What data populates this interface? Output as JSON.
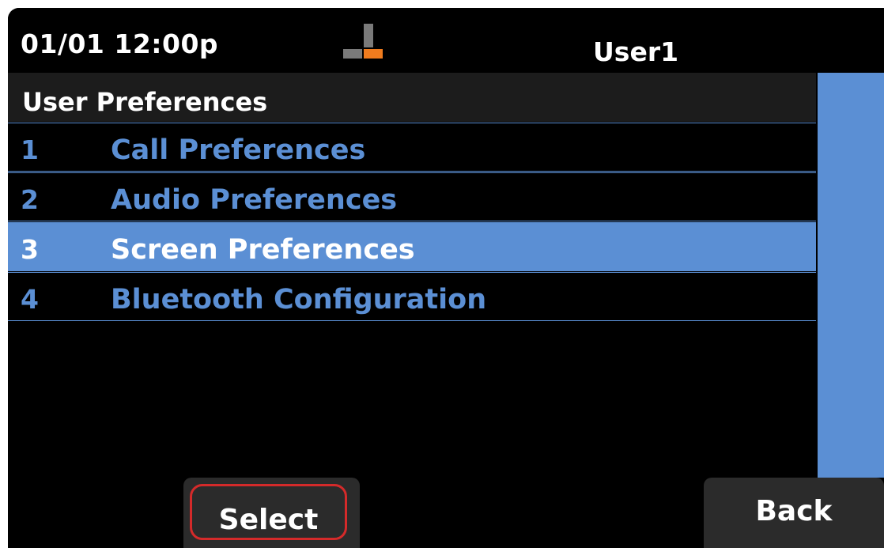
{
  "status_bar": {
    "datetime": "01/01 12:00p",
    "line_icon": "phone-line-status-icon",
    "user": "User1"
  },
  "menu": {
    "title": "User Preferences",
    "items": [
      {
        "number": "1",
        "label": "Call Preferences",
        "selected": false
      },
      {
        "number": "2",
        "label": "Audio Preferences",
        "selected": false
      },
      {
        "number": "3",
        "label": "Screen Preferences",
        "selected": true
      },
      {
        "number": "4",
        "label": "Bluetooth Configuration",
        "selected": false
      }
    ]
  },
  "softkeys": {
    "select_label": "Select",
    "back_label": "Back"
  },
  "colors": {
    "accent": "#5b8fd4",
    "background": "#000000",
    "focus_ring": "#d42a2a",
    "line_indicator": "#f07c1e"
  }
}
